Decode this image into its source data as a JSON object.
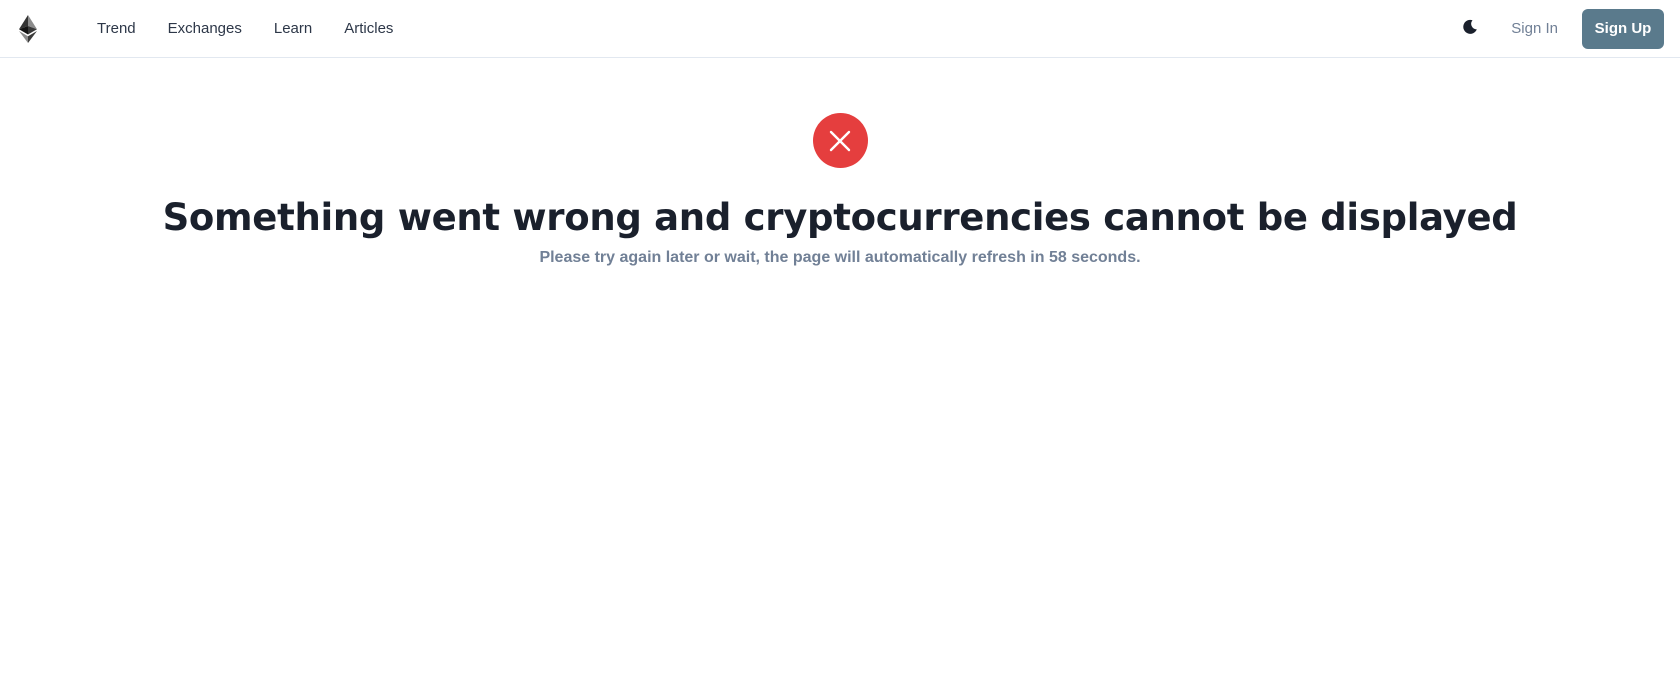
{
  "header": {
    "logo_icon": "ethereum-logo-icon",
    "nav": [
      {
        "label": "Trend"
      },
      {
        "label": "Exchanges"
      },
      {
        "label": "Learn"
      },
      {
        "label": "Articles"
      }
    ],
    "theme_toggle_icon": "moon-icon",
    "signin_label": "Sign In",
    "signup_label": "Sign Up"
  },
  "error": {
    "icon": "close-icon",
    "title": "Something went wrong and cryptocurrencies cannot be displayed",
    "message": "Please try again later or wait, the page will automatically refresh in 58 seconds."
  },
  "colors": {
    "error_red": "#e53e3e",
    "signup_bg": "#5a7a8c",
    "heading": "#1a202c",
    "muted": "#718096"
  }
}
